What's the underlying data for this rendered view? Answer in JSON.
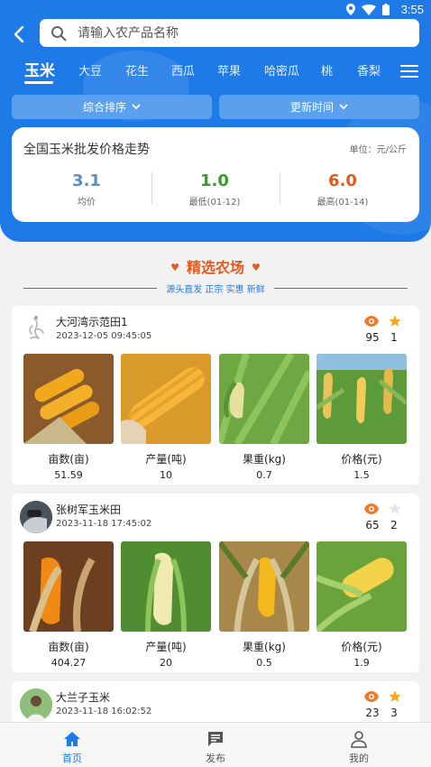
{
  "status_bar": {
    "time": "3:55"
  },
  "search": {
    "placeholder": "请输入农产品名称"
  },
  "category_tabs": [
    "玉米",
    "大豆",
    "花生",
    "西瓜",
    "苹果",
    "哈密瓜",
    "桃",
    "香梨"
  ],
  "active_tab": "玉米",
  "sort_buttons": [
    {
      "label": "综合排序"
    },
    {
      "label": "更新时间"
    }
  ],
  "price_card": {
    "title": "全国玉米批发价格走势",
    "unit": "单位：元/公斤",
    "stats": [
      {
        "value": "3.1",
        "label": "均价",
        "color": "#5b8fbd"
      },
      {
        "value": "1.0",
        "label": "最低(01-12)",
        "color": "#3a9a2c"
      },
      {
        "value": "6.0",
        "label": "最高(01-14)",
        "color": "#e35a1e"
      }
    ]
  },
  "section": {
    "title": "精选农场",
    "subtitle": "源头直发 正宗 实惠 新鲜"
  },
  "farms": [
    {
      "name": "大河湾示范田1",
      "date": "2023-12-05 09:45:05",
      "views": "95",
      "stars": "1",
      "starred": true,
      "stats": [
        {
          "label": "亩数(亩)",
          "value": "51.59"
        },
        {
          "label": "产量(吨)",
          "value": "10"
        },
        {
          "label": "果重(kg)",
          "value": "0.7"
        },
        {
          "label": "价格(元)",
          "value": "1.5"
        }
      ]
    },
    {
      "name": "张树军玉米田",
      "date": "2023-11-18 17:45:02",
      "views": "65",
      "stars": "2",
      "starred": false,
      "stats": [
        {
          "label": "亩数(亩)",
          "value": "404.27"
        },
        {
          "label": "产量(吨)",
          "value": "20"
        },
        {
          "label": "果重(kg)",
          "value": "0.5"
        },
        {
          "label": "价格(元)",
          "value": "1.9"
        }
      ]
    },
    {
      "name": "大兰子玉米",
      "date": "2023-11-18 16:02:52",
      "views": "23",
      "stars": "3",
      "starred": true,
      "stats": []
    }
  ],
  "bottom_nav": [
    {
      "label": "首页",
      "icon": "home-icon",
      "active": true
    },
    {
      "label": "发布",
      "icon": "message-icon",
      "active": false
    },
    {
      "label": "我的",
      "icon": "user-icon",
      "active": false
    }
  ],
  "colors": {
    "primary": "#1e7ae6",
    "accent": "#e35a1e",
    "star": "#f5a623",
    "eye": "#f07c2a"
  }
}
